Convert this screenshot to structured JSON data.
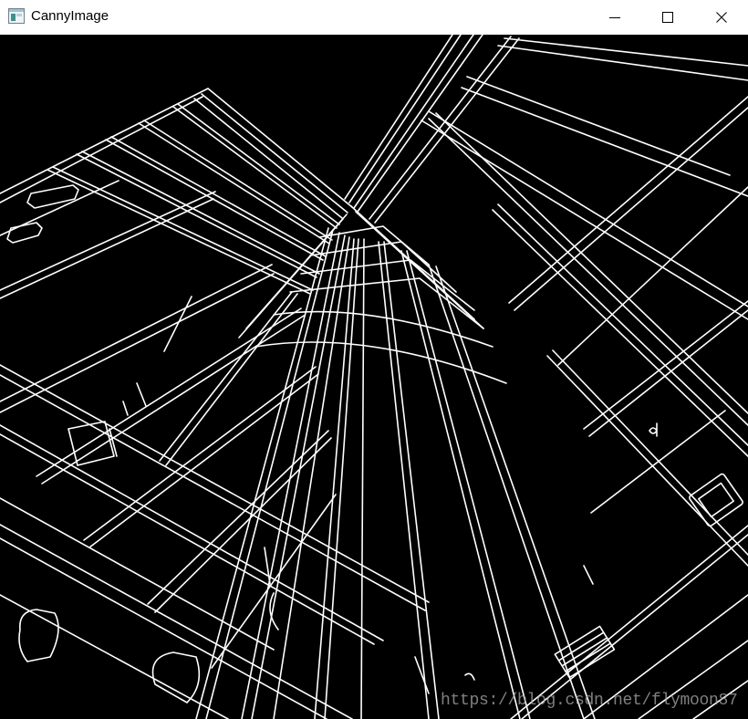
{
  "window": {
    "title": "CannyImage"
  },
  "title_bar": {
    "app_icon": "app-window-icon",
    "buttons": [
      {
        "name": "minimize",
        "icon": "minimize-icon"
      },
      {
        "name": "maximize",
        "icon": "maximize-icon"
      },
      {
        "name": "close",
        "icon": "close-icon"
      }
    ]
  },
  "image": {
    "background_color": "#000000",
    "edge_color": "#ffffff"
  },
  "watermark": {
    "text": "https://blog.csdn.net/flymoon87"
  }
}
